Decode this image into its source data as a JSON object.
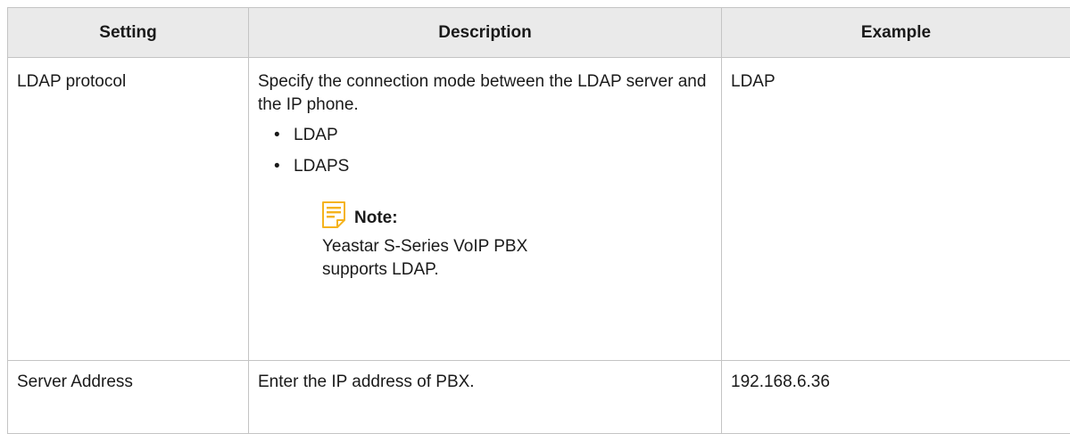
{
  "headers": {
    "setting": "Setting",
    "description": "Description",
    "example": "Example"
  },
  "rows": [
    {
      "setting": "LDAP protocol",
      "description": "Specify the connection mode between the LDAP server and the IP phone.",
      "options": [
        "LDAP",
        "LDAPS"
      ],
      "note": {
        "icon": "note-icon",
        "icon_color": "#f5b31c",
        "title": "Note:",
        "text": "Yeastar S-Series VoIP PBX supports LDAP."
      },
      "example": "LDAP"
    },
    {
      "setting": "Server Address",
      "description": "Enter the IP address of PBX.",
      "example": "192.168.6.36"
    }
  ],
  "bullet_char": "•",
  "colors": {
    "header_bg": "#eaeaea",
    "border": "#c4c4c4",
    "note_icon": "#f5b31c"
  }
}
